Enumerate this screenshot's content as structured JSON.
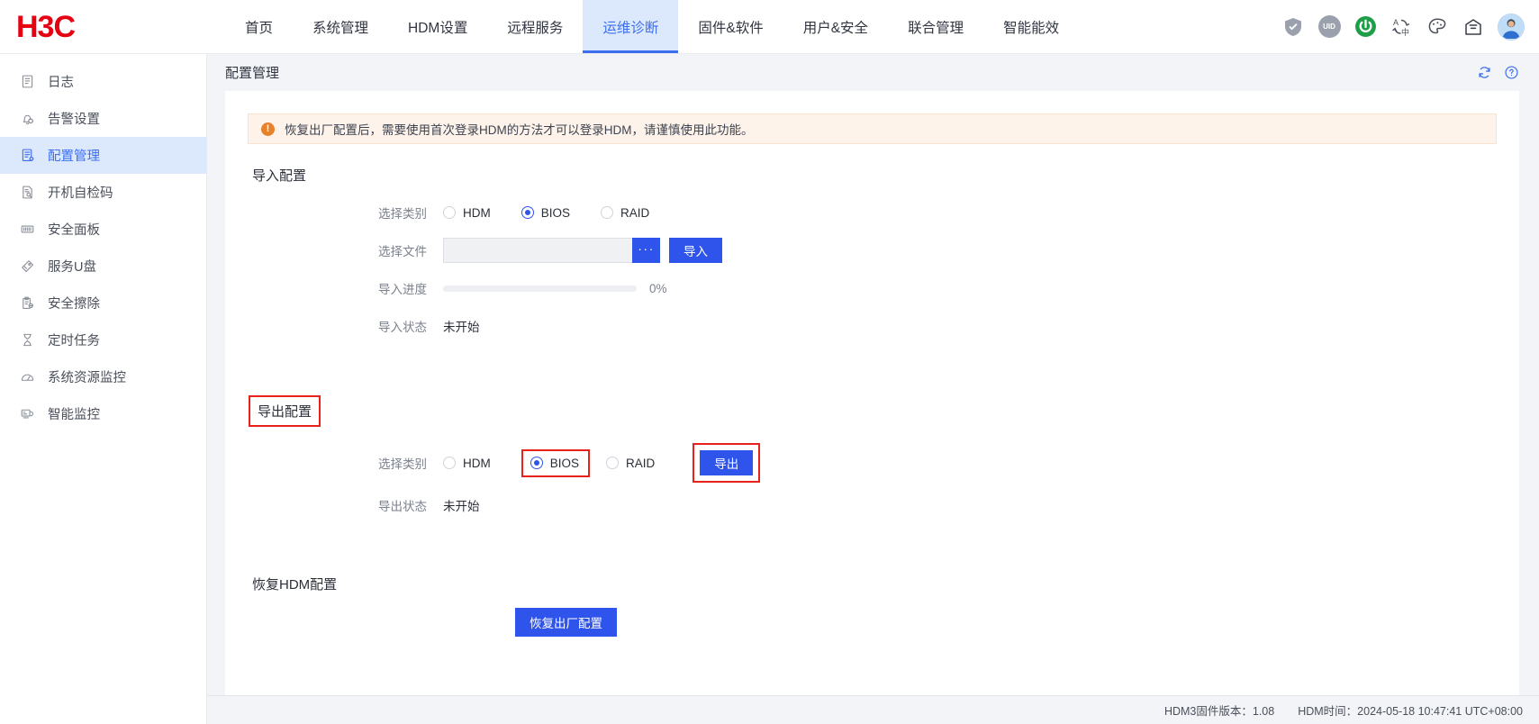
{
  "brand": {
    "logo_text": "H3C"
  },
  "topnav": {
    "items": [
      {
        "label": "首页",
        "active": false
      },
      {
        "label": "系统管理",
        "active": false
      },
      {
        "label": "HDM设置",
        "active": false
      },
      {
        "label": "远程服务",
        "active": false
      },
      {
        "label": "运维诊断",
        "active": true
      },
      {
        "label": "固件&软件",
        "active": false
      },
      {
        "label": "用户&安全",
        "active": false
      },
      {
        "label": "联合管理",
        "active": false
      },
      {
        "label": "智能能效",
        "active": false
      }
    ],
    "icons": [
      {
        "name": "shield-health-icon",
        "label": ""
      },
      {
        "name": "uid-icon",
        "label": "UID"
      },
      {
        "name": "power-icon",
        "label": ""
      },
      {
        "name": "language-switch-icon",
        "label": ""
      },
      {
        "name": "theme-palette-icon",
        "label": ""
      },
      {
        "name": "message-mail-icon",
        "label": ""
      },
      {
        "name": "user-avatar-icon",
        "label": ""
      }
    ]
  },
  "sidebar": {
    "items": [
      {
        "label": "日志",
        "icon": "log-icon",
        "active": false
      },
      {
        "label": "告警设置",
        "icon": "bell-alarm-icon",
        "active": false
      },
      {
        "label": "配置管理",
        "icon": "config-icon",
        "active": true
      },
      {
        "label": "开机自检码",
        "icon": "post-code-icon",
        "active": false
      },
      {
        "label": "安全面板",
        "icon": "security-panel-icon",
        "active": false
      },
      {
        "label": "服务U盘",
        "icon": "usb-drive-icon",
        "active": false
      },
      {
        "label": "安全擦除",
        "icon": "secure-erase-icon",
        "active": false
      },
      {
        "label": "定时任务",
        "icon": "scheduled-task-icon",
        "active": false
      },
      {
        "label": "系统资源监控",
        "icon": "resource-monitor-icon",
        "active": false
      },
      {
        "label": "智能监控",
        "icon": "smart-monitor-icon",
        "active": false
      }
    ]
  },
  "page": {
    "title": "配置管理",
    "refresh_icon": "refresh-icon",
    "help_icon": "help-icon"
  },
  "warning": {
    "icon": "exclamation-icon",
    "text": "恢复出厂配置后，需要使用首次登录HDM的方法才可以登录HDM，请谨慎使用此功能。"
  },
  "import_section": {
    "title": "导入配置",
    "category_label": "选择类别",
    "category_options": [
      {
        "label": "HDM",
        "selected": false
      },
      {
        "label": "BIOS",
        "selected": true
      },
      {
        "label": "RAID",
        "selected": false
      }
    ],
    "file_label": "选择文件",
    "file_value": "",
    "file_placeholder": "",
    "browse_button": "···",
    "import_button": "导入",
    "progress_label": "导入进度",
    "progress_percent": "0%",
    "progress_value": 0,
    "status_label": "导入状态",
    "status_value": "未开始"
  },
  "export_section": {
    "title": "导出配置",
    "category_label": "选择类别",
    "category_options": [
      {
        "label": "HDM",
        "selected": false
      },
      {
        "label": "BIOS",
        "selected": true
      },
      {
        "label": "RAID",
        "selected": false
      }
    ],
    "export_button": "导出",
    "status_label": "导出状态",
    "status_value": "未开始"
  },
  "restore_section": {
    "title": "恢复HDM配置",
    "restore_button": "恢复出厂配置"
  },
  "footer": {
    "firmware": "HDM3固件版本：1.08",
    "time": "HDM时间：2024-05-18 10:47:41 UTC+08:00"
  },
  "colors": {
    "brand_red": "#e60012",
    "primary_blue": "#2f54eb",
    "nav_active_bg": "#dce8fb",
    "nav_active_text": "#3c6ef0",
    "annotation_red": "#e8211a",
    "warning_bg": "#fdf3ea",
    "warning_icon": "#e8812b",
    "power_green": "#1e9e48"
  }
}
